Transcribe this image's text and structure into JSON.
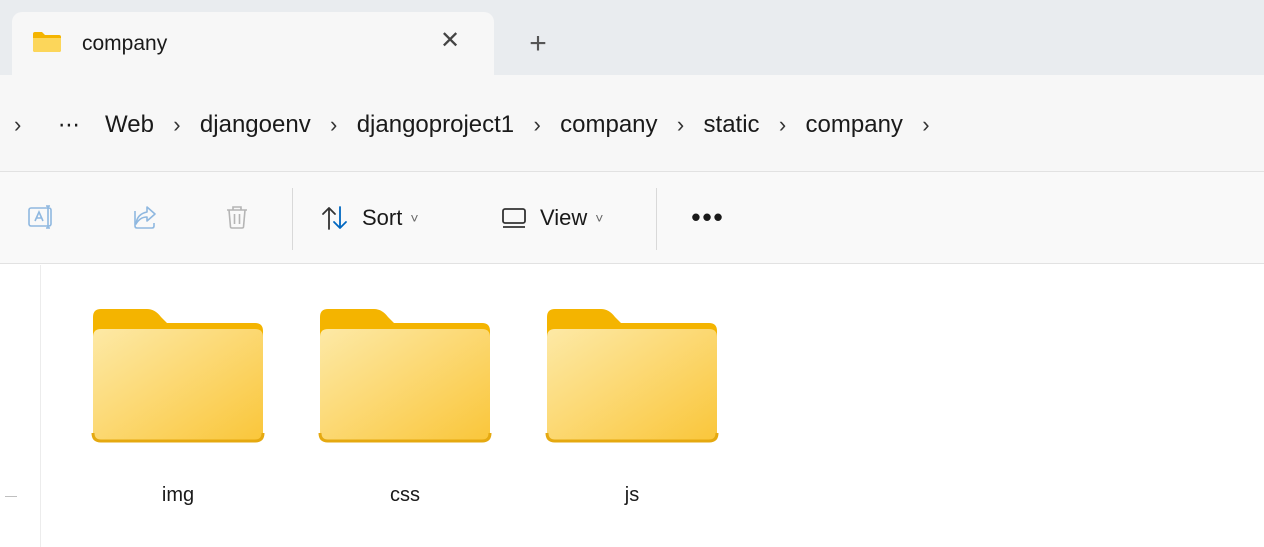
{
  "tab": {
    "title": "company",
    "icon": "folder-icon",
    "close_glyph": "✕",
    "new_tab_glyph": "+"
  },
  "breadcrumb": {
    "separator": "›",
    "more": "⋯",
    "items": [
      "Web",
      "djangoenv",
      "djangoproject1",
      "company",
      "static",
      "company"
    ]
  },
  "commandbar": {
    "rename_icon": "rename-icon",
    "share_icon": "share-icon",
    "delete_icon": "delete-icon",
    "sort_label": "Sort",
    "view_label": "View",
    "chevron": "˅",
    "more_glyph": "•••"
  },
  "folders": [
    {
      "name": "img"
    },
    {
      "name": "css"
    },
    {
      "name": "js"
    }
  ],
  "colors": {
    "folder_back": "#f4b400",
    "folder_front_light": "#fde58f",
    "folder_front_dark": "#f9c93b",
    "accent_blue": "#0067c0"
  }
}
